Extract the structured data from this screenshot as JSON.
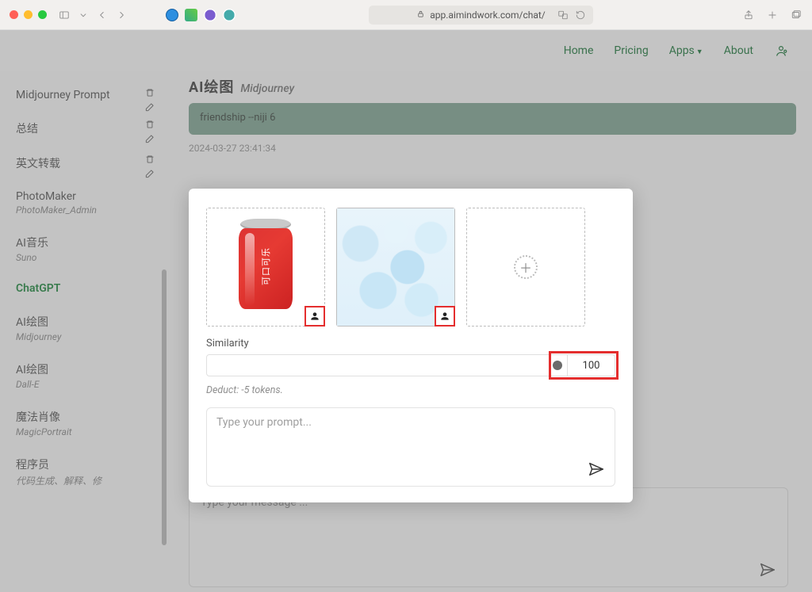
{
  "browser": {
    "url": "app.aimindwork.com/chat/"
  },
  "nav": {
    "home": "Home",
    "pricing": "Pricing",
    "apps": "Apps",
    "about": "About"
  },
  "sidebar": {
    "items": [
      {
        "title": "Midjourney Prompt",
        "sub": "",
        "actions": true
      },
      {
        "title": "总结",
        "sub": "",
        "actions": true
      },
      {
        "title": "英文转载",
        "sub": "",
        "actions": true
      },
      {
        "title": "PhotoMaker",
        "sub": "PhotoMaker_Admin",
        "actions": false
      },
      {
        "title": "AI音乐",
        "sub": "Suno",
        "actions": false
      },
      {
        "title": "ChatGPT",
        "sub": "",
        "actions": false,
        "active": true
      },
      {
        "title": "AI绘图",
        "sub": "Midjourney",
        "actions": false
      },
      {
        "title": "AI绘图",
        "sub": "Dall-E",
        "actions": false
      },
      {
        "title": "魔法肖像",
        "sub": "MagicPortrait",
        "actions": false
      },
      {
        "title": "程序员",
        "sub": "代码生成、解释、修",
        "actions": false
      }
    ]
  },
  "main": {
    "title_ai": "AI绘图",
    "title_sub": "Midjourney",
    "banner": "friendship --niji 6",
    "timestamp": "2024-03-27 23:41:34",
    "message_placeholder": "Type your message ..."
  },
  "modal": {
    "similarity_label": "Similarity",
    "similarity_value": "100",
    "deduct": "Deduct: -5 tokens.",
    "prompt_placeholder": "Type your prompt...",
    "can_label": "可口可乐"
  }
}
